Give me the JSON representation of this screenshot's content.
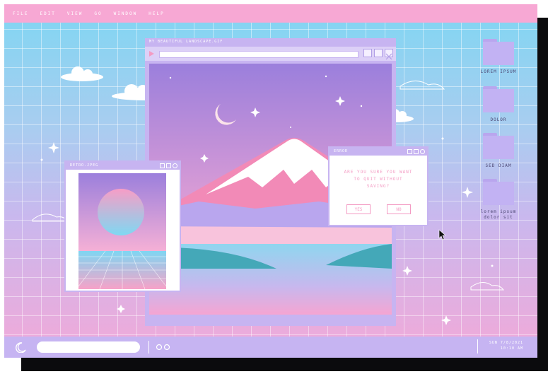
{
  "menubar": {
    "items": [
      "FILE",
      "EDIT",
      "VIEW",
      "GO",
      "WINDOW",
      "HELP"
    ]
  },
  "main_window": {
    "title": "MY BEAUTIFUL LANDSCAPE.GIF"
  },
  "image_window": {
    "title": "RETRO.JPEG"
  },
  "dialog": {
    "title": "ERROR",
    "message_line1": "ARE YOU SURE YOU WANT",
    "message_line2": "TO QUIT WITHOUT",
    "message_line3": "SAVING?",
    "yes_label": "YES",
    "no_label": "NO"
  },
  "desktop": {
    "folders": [
      {
        "label": "LOREM IPSUM"
      },
      {
        "label": "DOLOR"
      },
      {
        "label": "SED DIAM"
      },
      {
        "label_line1": "lorem ipsum",
        "label_line2": "dolor sit"
      }
    ]
  },
  "taskbar": {
    "start_icon": "crescent-moon-icon",
    "search_value": "",
    "clock_line1": "SUN 7/8/2021",
    "clock_line2": "10:10 AM"
  },
  "colors": {
    "menubar": "#f7a8d4",
    "taskbar": "#c6b4f2",
    "window_frame": "#c7b4f1",
    "accent_pink": "#f39bc3"
  }
}
